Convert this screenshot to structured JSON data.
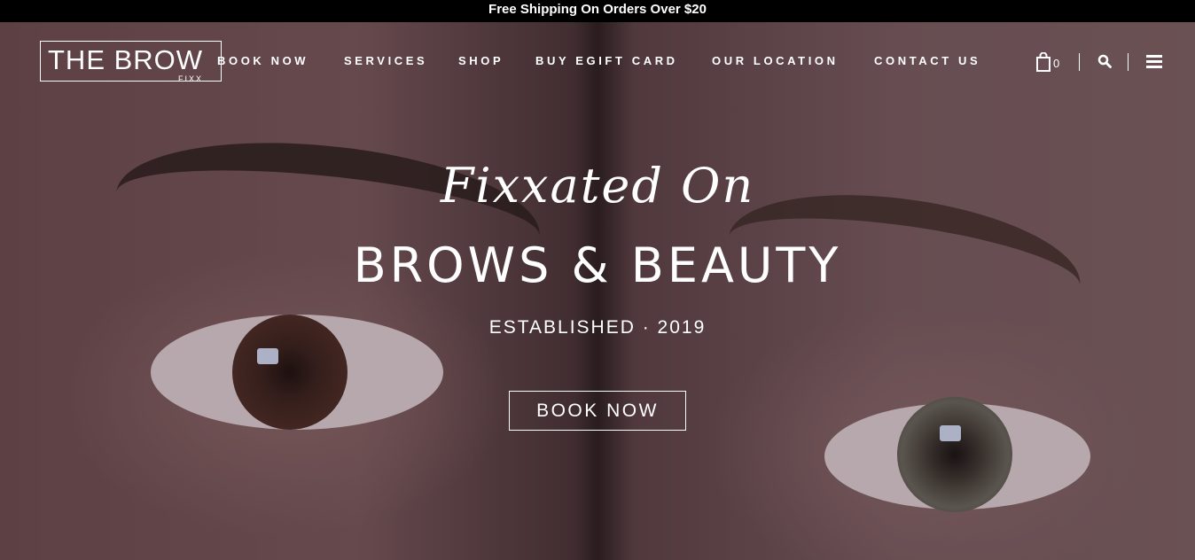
{
  "announcement": {
    "text": "Free Shipping On Orders Over $20"
  },
  "header": {
    "logo": {
      "main": "THE BROW",
      "sub": "FIXX"
    },
    "nav": [
      {
        "label": "BOOK NOW"
      },
      {
        "label": "SERVICES"
      },
      {
        "label": "SHOP"
      },
      {
        "label": "BUY EGIFT CARD"
      },
      {
        "label": "OUR LOCATION"
      },
      {
        "label": "CONTACT US"
      }
    ],
    "cart_count": "0",
    "icons": [
      "shopping-bag-icon",
      "search-icon",
      "menu-icon"
    ]
  },
  "hero": {
    "script_title": "Fixxated On",
    "headline": "BROWS & BEAUTY",
    "established": "ESTABLISHED · 2019",
    "cta_label": "BOOK NOW"
  },
  "colors": {
    "announcement_bg": "#000000",
    "text": "#ffffff"
  }
}
